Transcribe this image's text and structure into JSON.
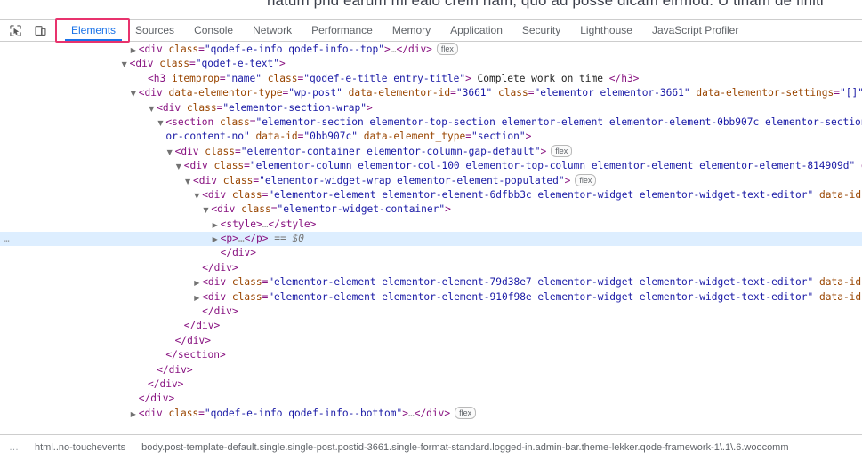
{
  "page_bleed": {
    "text": "natum phd earum mi ealo crem nam, quo ad posse dicam eirmod. U tinam de finiti"
  },
  "toolbar": {
    "icons": [
      {
        "name": "inspect-element-icon"
      },
      {
        "name": "device-toolbar-icon"
      }
    ],
    "tabs": [
      {
        "label": "Elements",
        "selected": true
      },
      {
        "label": "Sources",
        "selected": false
      },
      {
        "label": "Console",
        "selected": false
      },
      {
        "label": "Network",
        "selected": false
      },
      {
        "label": "Performance",
        "selected": false
      },
      {
        "label": "Memory",
        "selected": false
      },
      {
        "label": "Application",
        "selected": false
      },
      {
        "label": "Security",
        "selected": false
      },
      {
        "label": "Lighthouse",
        "selected": false
      },
      {
        "label": "JavaScript Profiler",
        "selected": false
      }
    ],
    "annotation_color": "#e8336d",
    "accent_color": "#1a73e8"
  },
  "dom_tree": {
    "selection_marker": "== $0",
    "selection_highlight_color": "#ddeeff",
    "nodes": [
      {
        "indent": 9,
        "twisty": "collapsed",
        "selected": false,
        "badge": "flex",
        "tokens": [
          {
            "t": "pun",
            "v": "<div "
          },
          {
            "t": "attr",
            "v": "class"
          },
          {
            "t": "pun",
            "v": "="
          },
          {
            "t": "val",
            "v": "\"qodef-e-info qodef-info--top\""
          },
          {
            "t": "pun",
            "v": ">"
          },
          {
            "t": "dots",
            "v": "…"
          },
          {
            "t": "pun",
            "v": "</div>"
          }
        ]
      },
      {
        "indent": 8,
        "twisty": "expanded",
        "selected": false,
        "badge": null,
        "tokens": [
          {
            "t": "pun",
            "v": "<div "
          },
          {
            "t": "attr",
            "v": "class"
          },
          {
            "t": "pun",
            "v": "="
          },
          {
            "t": "val",
            "v": "\"qodef-e-text\""
          },
          {
            "t": "pun",
            "v": ">"
          }
        ]
      },
      {
        "indent": 10,
        "twisty": "none",
        "selected": false,
        "badge": null,
        "tokens": [
          {
            "t": "pun",
            "v": "<h3 "
          },
          {
            "t": "attr",
            "v": "itemprop"
          },
          {
            "t": "pun",
            "v": "="
          },
          {
            "t": "val",
            "v": "\"name\""
          },
          {
            "t": "pun",
            "v": " "
          },
          {
            "t": "attr",
            "v": "class"
          },
          {
            "t": "pun",
            "v": "="
          },
          {
            "t": "val",
            "v": "\"qodef-e-title entry-title\""
          },
          {
            "t": "pun",
            "v": ">"
          },
          {
            "t": "txt",
            "v": " Complete work on time "
          },
          {
            "t": "pun",
            "v": "</h3>"
          }
        ]
      },
      {
        "indent": 9,
        "twisty": "expanded",
        "selected": false,
        "badge": null,
        "tokens": [
          {
            "t": "pun",
            "v": "<div "
          },
          {
            "t": "attr",
            "v": "data-elementor-type"
          },
          {
            "t": "pun",
            "v": "="
          },
          {
            "t": "val",
            "v": "\"wp-post\""
          },
          {
            "t": "pun",
            "v": " "
          },
          {
            "t": "attr",
            "v": "data-elementor-id"
          },
          {
            "t": "pun",
            "v": "="
          },
          {
            "t": "val",
            "v": "\"3661\""
          },
          {
            "t": "pun",
            "v": " "
          },
          {
            "t": "attr",
            "v": "class"
          },
          {
            "t": "pun",
            "v": "="
          },
          {
            "t": "val",
            "v": "\"elementor elementor-3661\""
          },
          {
            "t": "pun",
            "v": " "
          },
          {
            "t": "attr",
            "v": "data-elementor-settings"
          },
          {
            "t": "pun",
            "v": "="
          },
          {
            "t": "val",
            "v": "\"[]\""
          }
        ]
      },
      {
        "indent": 11,
        "twisty": "expanded",
        "selected": false,
        "badge": null,
        "tokens": [
          {
            "t": "pun",
            "v": "<div "
          },
          {
            "t": "attr",
            "v": "class"
          },
          {
            "t": "pun",
            "v": "="
          },
          {
            "t": "val",
            "v": "\"elementor-section-wrap\""
          },
          {
            "t": "pun",
            "v": ">"
          }
        ]
      },
      {
        "indent": 12,
        "twisty": "expanded",
        "selected": false,
        "badge": null,
        "tokens": [
          {
            "t": "pun",
            "v": "<section "
          },
          {
            "t": "attr",
            "v": "class"
          },
          {
            "t": "pun",
            "v": "="
          },
          {
            "t": "val",
            "v": "\"elementor-section elementor-top-section elementor-element elementor-element-0bb907c elementor-section-"
          }
        ]
      },
      {
        "indent": 12,
        "twisty": "none",
        "selected": false,
        "badge": null,
        "tokens": [
          {
            "t": "val",
            "v": "or-content-no\""
          },
          {
            "t": "pun",
            "v": " "
          },
          {
            "t": "attr",
            "v": "data-id"
          },
          {
            "t": "pun",
            "v": "="
          },
          {
            "t": "val",
            "v": "\"0bb907c\""
          },
          {
            "t": "pun",
            "v": " "
          },
          {
            "t": "attr",
            "v": "data-element_type"
          },
          {
            "t": "pun",
            "v": "="
          },
          {
            "t": "val",
            "v": "\"section\""
          },
          {
            "t": "pun",
            "v": ">"
          }
        ]
      },
      {
        "indent": 13,
        "twisty": "expanded",
        "selected": false,
        "badge": "flex",
        "tokens": [
          {
            "t": "pun",
            "v": "<div "
          },
          {
            "t": "attr",
            "v": "class"
          },
          {
            "t": "pun",
            "v": "="
          },
          {
            "t": "val",
            "v": "\"elementor-container elementor-column-gap-default\""
          },
          {
            "t": "pun",
            "v": ">"
          }
        ]
      },
      {
        "indent": 14,
        "twisty": "expanded",
        "selected": false,
        "badge": null,
        "tokens": [
          {
            "t": "pun",
            "v": "<div "
          },
          {
            "t": "attr",
            "v": "class"
          },
          {
            "t": "pun",
            "v": "="
          },
          {
            "t": "val",
            "v": "\"elementor-column elementor-col-100 elementor-top-column elementor-element elementor-element-814909d\""
          },
          {
            "t": "pun",
            "v": " d"
          }
        ]
      },
      {
        "indent": 15,
        "twisty": "expanded",
        "selected": false,
        "badge": "flex",
        "tokens": [
          {
            "t": "pun",
            "v": "<div "
          },
          {
            "t": "attr",
            "v": "class"
          },
          {
            "t": "pun",
            "v": "="
          },
          {
            "t": "val",
            "v": "\"elementor-widget-wrap elementor-element-populated\""
          },
          {
            "t": "pun",
            "v": ">"
          }
        ]
      },
      {
        "indent": 16,
        "twisty": "expanded",
        "selected": false,
        "badge": null,
        "tokens": [
          {
            "t": "pun",
            "v": "<div "
          },
          {
            "t": "attr",
            "v": "class"
          },
          {
            "t": "pun",
            "v": "="
          },
          {
            "t": "val",
            "v": "\"elementor-element elementor-element-6dfbb3c elementor-widget elementor-widget-text-editor\""
          },
          {
            "t": "pun",
            "v": " "
          },
          {
            "t": "attr",
            "v": "data-id"
          }
        ]
      },
      {
        "indent": 17,
        "twisty": "expanded",
        "selected": false,
        "badge": null,
        "tokens": [
          {
            "t": "pun",
            "v": "<div "
          },
          {
            "t": "attr",
            "v": "class"
          },
          {
            "t": "pun",
            "v": "="
          },
          {
            "t": "val",
            "v": "\"elementor-widget-container\""
          },
          {
            "t": "pun",
            "v": ">"
          }
        ]
      },
      {
        "indent": 18,
        "twisty": "collapsed",
        "selected": false,
        "badge": null,
        "tokens": [
          {
            "t": "pun",
            "v": "<style>"
          },
          {
            "t": "dots",
            "v": "…"
          },
          {
            "t": "pun",
            "v": "</style>"
          }
        ]
      },
      {
        "indent": 18,
        "twisty": "collapsed",
        "selected": true,
        "badge": null,
        "tokens": [
          {
            "t": "pun",
            "v": "<p>"
          },
          {
            "t": "dots",
            "v": "…"
          },
          {
            "t": "pun",
            "v": "</p>"
          },
          {
            "t": "sel0",
            "v": "  == $0"
          }
        ]
      },
      {
        "indent": 18,
        "twisty": "none",
        "selected": false,
        "badge": null,
        "tokens": [
          {
            "t": "pun",
            "v": "</div>"
          }
        ]
      },
      {
        "indent": 16,
        "twisty": "none",
        "selected": false,
        "badge": null,
        "tokens": [
          {
            "t": "pun",
            "v": "</div>"
          }
        ]
      },
      {
        "indent": 16,
        "twisty": "collapsed",
        "selected": false,
        "badge": null,
        "tokens": [
          {
            "t": "pun",
            "v": "<div "
          },
          {
            "t": "attr",
            "v": "class"
          },
          {
            "t": "pun",
            "v": "="
          },
          {
            "t": "val",
            "v": "\"elementor-element elementor-element-79d38e7 elementor-widget elementor-widget-text-editor\""
          },
          {
            "t": "pun",
            "v": " "
          },
          {
            "t": "attr",
            "v": "data-id"
          }
        ]
      },
      {
        "indent": 16,
        "twisty": "collapsed",
        "selected": false,
        "badge": null,
        "tokens": [
          {
            "t": "pun",
            "v": "<div "
          },
          {
            "t": "attr",
            "v": "class"
          },
          {
            "t": "pun",
            "v": "="
          },
          {
            "t": "val",
            "v": "\"elementor-element elementor-element-910f98e elementor-widget elementor-widget-text-editor\""
          },
          {
            "t": "pun",
            "v": " "
          },
          {
            "t": "attr",
            "v": "data-id"
          }
        ]
      },
      {
        "indent": 16,
        "twisty": "none",
        "selected": false,
        "badge": null,
        "tokens": [
          {
            "t": "pun",
            "v": "</div>"
          }
        ]
      },
      {
        "indent": 14,
        "twisty": "none",
        "selected": false,
        "badge": null,
        "tokens": [
          {
            "t": "pun",
            "v": "</div>"
          }
        ]
      },
      {
        "indent": 13,
        "twisty": "none",
        "selected": false,
        "badge": null,
        "tokens": [
          {
            "t": "pun",
            "v": "</div>"
          }
        ]
      },
      {
        "indent": 12,
        "twisty": "none",
        "selected": false,
        "badge": null,
        "tokens": [
          {
            "t": "pun",
            "v": "</section>"
          }
        ]
      },
      {
        "indent": 11,
        "twisty": "none",
        "selected": false,
        "badge": null,
        "tokens": [
          {
            "t": "pun",
            "v": "</div>"
          }
        ]
      },
      {
        "indent": 10,
        "twisty": "none",
        "selected": false,
        "badge": null,
        "tokens": [
          {
            "t": "pun",
            "v": "</div>"
          }
        ]
      },
      {
        "indent": 9,
        "twisty": "none",
        "selected": false,
        "badge": null,
        "tokens": [
          {
            "t": "pun",
            "v": "</div>"
          }
        ]
      },
      {
        "indent": 9,
        "twisty": "collapsed",
        "selected": false,
        "badge": "flex",
        "tokens": [
          {
            "t": "pun",
            "v": "<div "
          },
          {
            "t": "attr",
            "v": "class"
          },
          {
            "t": "pun",
            "v": "="
          },
          {
            "t": "val",
            "v": "\"qodef-e-info qodef-info--bottom\""
          },
          {
            "t": "pun",
            "v": ">"
          },
          {
            "t": "dots",
            "v": "…"
          },
          {
            "t": "pun",
            "v": "</div>"
          }
        ]
      }
    ]
  },
  "breadcrumb": {
    "ellipsis": "…",
    "items": [
      "html..no-touchevents",
      "body.post-template-default.single.single-post.postid-3661.single-format-standard.logged-in.admin-bar.theme-lekker.qode-framework-1\\.1\\.6.woocomm"
    ]
  }
}
